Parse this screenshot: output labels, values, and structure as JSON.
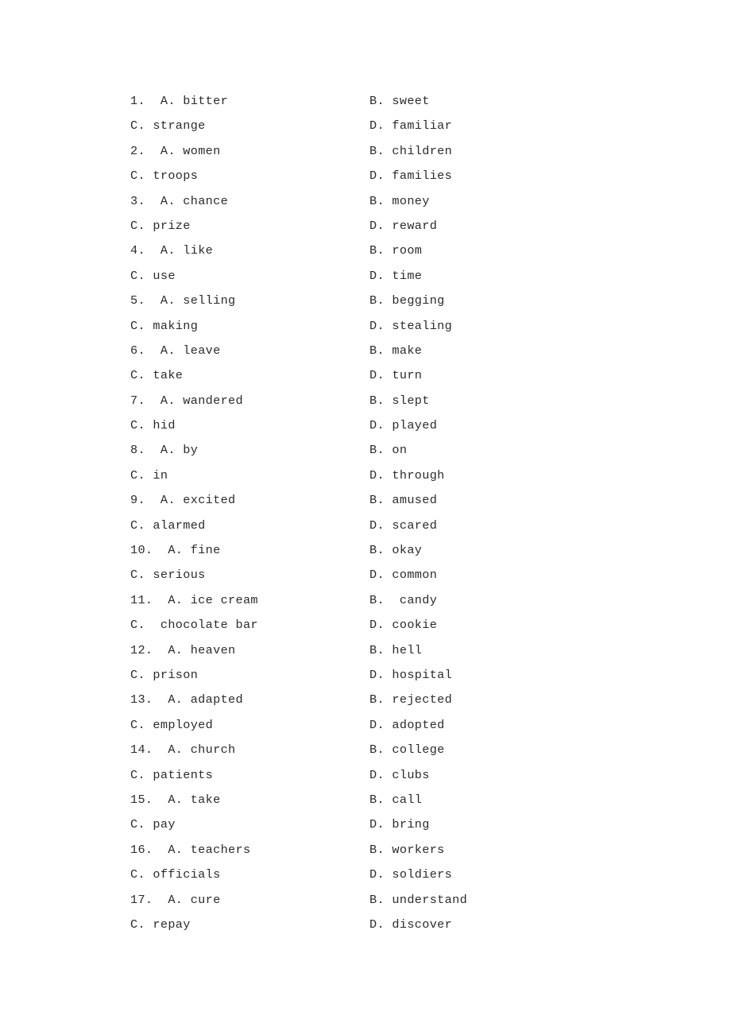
{
  "document": {
    "type": "multiple-choice-options-sheet",
    "background_color": "#ffffff",
    "text_color": "#2b2b2b",
    "total_questions": 17,
    "columns": 2,
    "option_letters": [
      "A.",
      "B.",
      "C.",
      "D."
    ]
  },
  "questions": [
    {
      "number": "1.",
      "line1": {
        "left_label": "1.  A.",
        "left_word": " bitter",
        "right_label": "B.",
        "right_word": " sweet"
      },
      "line2": {
        "left_label": "C.",
        "left_word": " strange",
        "right_label": "D.",
        "right_word": " familiar"
      }
    },
    {
      "number": "2.",
      "line1": {
        "left_label": "2.  A.",
        "left_word": " women",
        "right_label": "B.",
        "right_word": " children"
      },
      "line2": {
        "left_label": "C.",
        "left_word": " troops",
        "right_label": "D.",
        "right_word": " families"
      }
    },
    {
      "number": "3.",
      "line1": {
        "left_label": "3.  A.",
        "left_word": " chance",
        "right_label": "B.",
        "right_word": " money"
      },
      "line2": {
        "left_label": "C.",
        "left_word": " prize",
        "right_label": "D.",
        "right_word": " reward"
      }
    },
    {
      "number": "4.",
      "line1": {
        "left_label": "4.  A.",
        "left_word": " like",
        "right_label": "B.",
        "right_word": " room"
      },
      "line2": {
        "left_label": "C.",
        "left_word": " use",
        "right_label": "D.",
        "right_word": " time"
      }
    },
    {
      "number": "5.",
      "line1": {
        "left_label": "5.  A.",
        "left_word": " selling",
        "right_label": "B.",
        "right_word": " begging"
      },
      "line2": {
        "left_label": "C.",
        "left_word": " making",
        "right_label": "D.",
        "right_word": " stealing"
      }
    },
    {
      "number": "6.",
      "line1": {
        "left_label": "6.  A.",
        "left_word": " leave",
        "right_label": "B.",
        "right_word": " make"
      },
      "line2": {
        "left_label": "C.",
        "left_word": " take",
        "right_label": "D.",
        "right_word": " turn"
      }
    },
    {
      "number": "7.",
      "line1": {
        "left_label": "7.  A.",
        "left_word": " wandered",
        "right_label": "B.",
        "right_word": " slept"
      },
      "line2": {
        "left_label": "C.",
        "left_word": " hid",
        "right_label": "D.",
        "right_word": " played"
      }
    },
    {
      "number": "8.",
      "line1": {
        "left_label": "8.  A.",
        "left_word": " by",
        "right_label": "B.",
        "right_word": " on"
      },
      "line2": {
        "left_label": "C.",
        "left_word": " in",
        "right_label": "D.",
        "right_word": " through"
      }
    },
    {
      "number": "9.",
      "line1": {
        "left_label": "9.  A.",
        "left_word": " excited",
        "right_label": "B.",
        "right_word": " amused"
      },
      "line2": {
        "left_label": "C.",
        "left_word": " alarmed",
        "right_label": "D.",
        "right_word": " scared"
      }
    },
    {
      "number": "10.",
      "line1": {
        "left_label": "10.  A.",
        "left_word": " fine",
        "right_label": "B.",
        "right_word": " okay"
      },
      "line2": {
        "left_label": "C.",
        "left_word": " serious",
        "right_label": "D.",
        "right_word": " common"
      }
    },
    {
      "number": "11.",
      "line1": {
        "left_label": "11.  A.",
        "left_word": " ice cream",
        "right_label": "B.",
        "right_word": "  candy"
      },
      "line2": {
        "left_label": "C.",
        "left_word": "  chocolate bar",
        "right_label": "D.",
        "right_word": " cookie"
      }
    },
    {
      "number": "12.",
      "line1": {
        "left_label": "12.  A.",
        "left_word": " heaven",
        "right_label": "B.",
        "right_word": " hell"
      },
      "line2": {
        "left_label": "C.",
        "left_word": " prison",
        "right_label": "D.",
        "right_word": " hospital"
      }
    },
    {
      "number": "13.",
      "line1": {
        "left_label": "13.  A.",
        "left_word": " adapted",
        "right_label": "B.",
        "right_word": " rejected"
      },
      "line2": {
        "left_label": "C.",
        "left_word": " employed",
        "right_label": "D.",
        "right_word": " adopted"
      }
    },
    {
      "number": "14.",
      "line1": {
        "left_label": "14.  A.",
        "left_word": " church",
        "right_label": "B.",
        "right_word": " college"
      },
      "line2": {
        "left_label": "C.",
        "left_word": " patients",
        "right_label": "D.",
        "right_word": " clubs"
      }
    },
    {
      "number": "15.",
      "line1": {
        "left_label": "15.  A.",
        "left_word": " take",
        "right_label": "B.",
        "right_word": " call"
      },
      "line2": {
        "left_label": "C.",
        "left_word": " pay",
        "right_label": "D.",
        "right_word": " bring"
      }
    },
    {
      "number": "16.",
      "line1": {
        "left_label": "16.  A.",
        "left_word": " teachers",
        "right_label": "B.",
        "right_word": " workers"
      },
      "line2": {
        "left_label": "C.",
        "left_word": " officials",
        "right_label": "D.",
        "right_word": " soldiers"
      }
    },
    {
      "number": "17.",
      "line1": {
        "left_label": "17.  A.",
        "left_word": " cure",
        "right_label": "B.",
        "right_word": " understand"
      },
      "line2": {
        "left_label": "C.",
        "left_word": " repay",
        "right_label": "D.",
        "right_word": " discover"
      }
    }
  ]
}
